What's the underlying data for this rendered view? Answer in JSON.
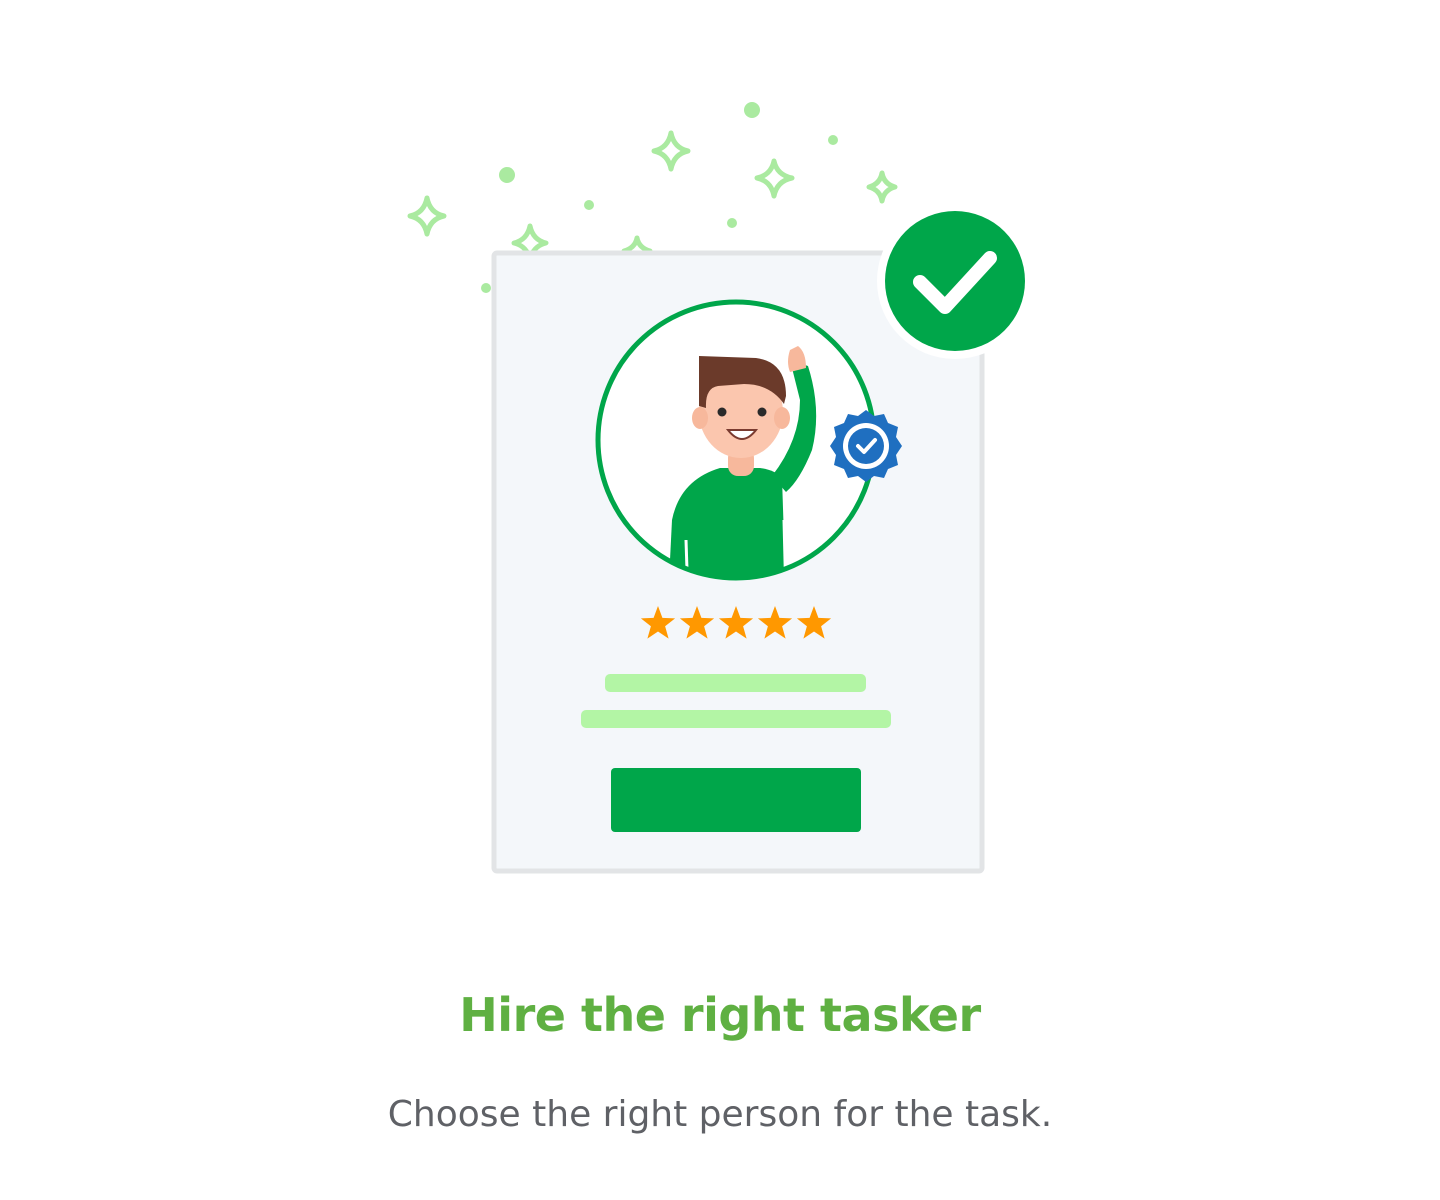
{
  "heading": {
    "title": "Hire the right tasker",
    "subtitle": "Choose the right person for the task."
  },
  "illustration": {
    "rating_stars": 5,
    "icons": [
      "sparkle-icon",
      "check-circle-icon",
      "verified-badge-icon",
      "star-icon",
      "person-avatar"
    ]
  },
  "colors": {
    "title": "#5fb042",
    "subtitle": "#5f6166",
    "brand_green": "#00a64a",
    "light_green": "#b3f5a5",
    "sparkle_green": "#aaeaa0",
    "badge_blue": "#1f6fc0",
    "star_orange": "#ff9800",
    "card_bg": "#f4f7fa",
    "card_border": "#e2e4e6"
  }
}
